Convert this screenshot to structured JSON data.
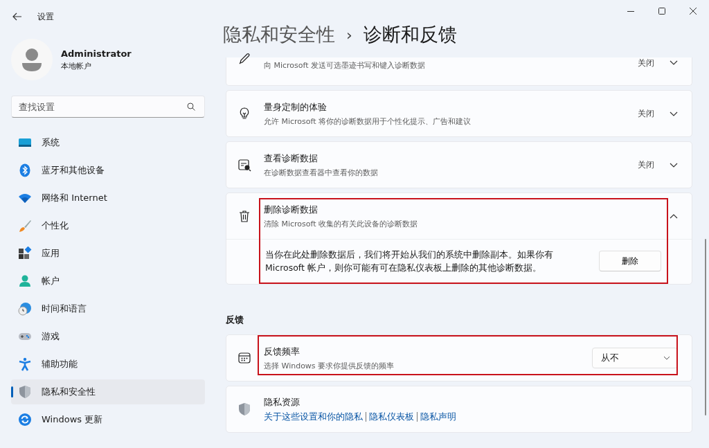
{
  "window": {
    "title": "设置"
  },
  "account": {
    "name": "Administrator",
    "type": "本地帐户"
  },
  "search": {
    "placeholder": "查找设置"
  },
  "sidebar": {
    "items": [
      {
        "label": "系统",
        "kind": "system",
        "selected": false
      },
      {
        "label": "蓝牙和其他设备",
        "kind": "bluetooth",
        "selected": false
      },
      {
        "label": "网络和 Internet",
        "kind": "wifi",
        "selected": false
      },
      {
        "label": "个性化",
        "kind": "brush",
        "selected": false
      },
      {
        "label": "应用",
        "kind": "apps",
        "selected": false
      },
      {
        "label": "帐户",
        "kind": "person",
        "selected": false
      },
      {
        "label": "时间和语言",
        "kind": "clock",
        "selected": false
      },
      {
        "label": "游戏",
        "kind": "gamepad",
        "selected": false
      },
      {
        "label": "辅助功能",
        "kind": "accessibility",
        "selected": false
      },
      {
        "label": "隐私和安全性",
        "kind": "shield",
        "selected": true
      },
      {
        "label": "Windows 更新",
        "kind": "update",
        "selected": false
      }
    ]
  },
  "breadcrumb": {
    "parent": "隐私和安全性",
    "separator": "›",
    "current": "诊断和反馈"
  },
  "groups": [
    {
      "cards": [
        {
          "kind": "expander",
          "description": "向 Microsoft 发送可选墨迹书写和键入诊断数据",
          "value": "关闭",
          "expanded": false,
          "highlighted": false
        },
        {
          "kind": "expander",
          "title": "量身定制的体验",
          "description": "允许 Microsoft 将你的诊断数据用于个性化提示、广告和建议",
          "value": "关闭",
          "expanded": false,
          "highlighted": false
        },
        {
          "kind": "expander",
          "title": "查看诊断数据",
          "description": "在诊断数据查看器中查看你的数据",
          "value": "关闭",
          "expanded": false,
          "highlighted": false
        },
        {
          "kind": "expander",
          "title": "删除诊断数据",
          "description": "清除 Microsoft 收集的有关此设备的诊断数据",
          "expanded": true,
          "highlighted": true,
          "body": {
            "text": "当你在此处删除数据后，我们将开始从我们的系统中删除副本。如果你有 Microsoft 帐户，则你可能有可在隐私仪表板上删除的其他诊断数据。",
            "button": "删除"
          }
        }
      ]
    },
    {
      "heading": "反馈",
      "cards": [
        {
          "kind": "dropdown",
          "title": "反馈频率",
          "description": "选择 Windows 要求你提供反馈的频率",
          "value": "从不",
          "highlighted": true
        },
        {
          "kind": "links",
          "title": "隐私资源",
          "links": [
            "关于这些设置和你的隐私",
            "隐私仪表板",
            "隐私声明"
          ],
          "highlighted": false
        }
      ]
    }
  ]
}
